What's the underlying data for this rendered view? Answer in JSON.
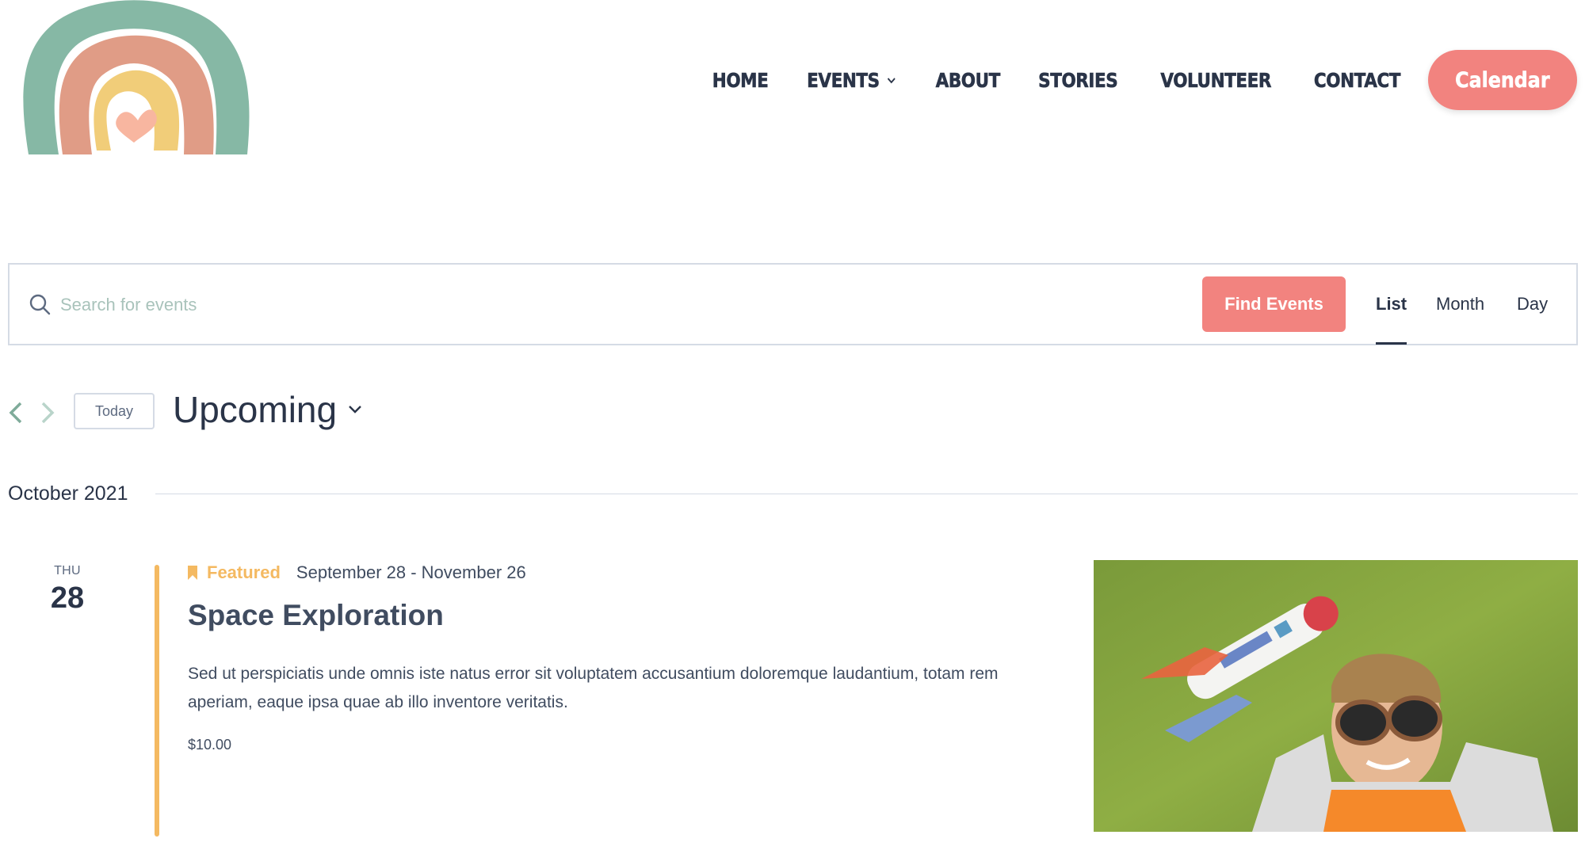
{
  "header": {
    "logo_alt": "Rainbow logo",
    "nav": [
      {
        "label": "HOME",
        "has_dropdown": false
      },
      {
        "label": "EVENTS",
        "has_dropdown": true
      },
      {
        "label": "ABOUT",
        "has_dropdown": false
      },
      {
        "label": "STORIES",
        "has_dropdown": false
      },
      {
        "label": "VOLUNTEER",
        "has_dropdown": false
      },
      {
        "label": "CONTACT",
        "has_dropdown": false
      }
    ],
    "cta_label": "Calendar"
  },
  "search": {
    "placeholder": "Search for events",
    "value": "",
    "button_label": "Find Events",
    "icon": "search-icon",
    "views": [
      {
        "label": "List",
        "active": true
      },
      {
        "label": "Month",
        "active": false
      },
      {
        "label": "Day",
        "active": false
      }
    ]
  },
  "toolbar": {
    "prev_icon": "chevron-left-icon",
    "next_icon": "chevron-right-icon",
    "today_label": "Today",
    "range_label": "Upcoming"
  },
  "month_separator": "October 2021",
  "events": [
    {
      "day_of_week": "THU",
      "day": "28",
      "featured_label": "Featured",
      "date_range": "September 28 - November 26",
      "title": "Space Exploration",
      "description": "Sed ut perspiciatis unde omnis iste natus error sit voluptatem accusantium doloremque laudantium, totam rem aperiam, eaque ipsa quae ab illo inventore veritatis.",
      "price": "$10.00",
      "image_alt": "Boy in aviator goggles lying on grass with a toy space rocket"
    }
  ],
  "colors": {
    "accent": "#f2837f",
    "featured": "#f4b961",
    "text_dark": "#2a3448",
    "logo_green": "#86b8a5",
    "logo_salmon": "#e09c86",
    "logo_yellow": "#f1cd79",
    "logo_heart": "#f8b6a0"
  }
}
